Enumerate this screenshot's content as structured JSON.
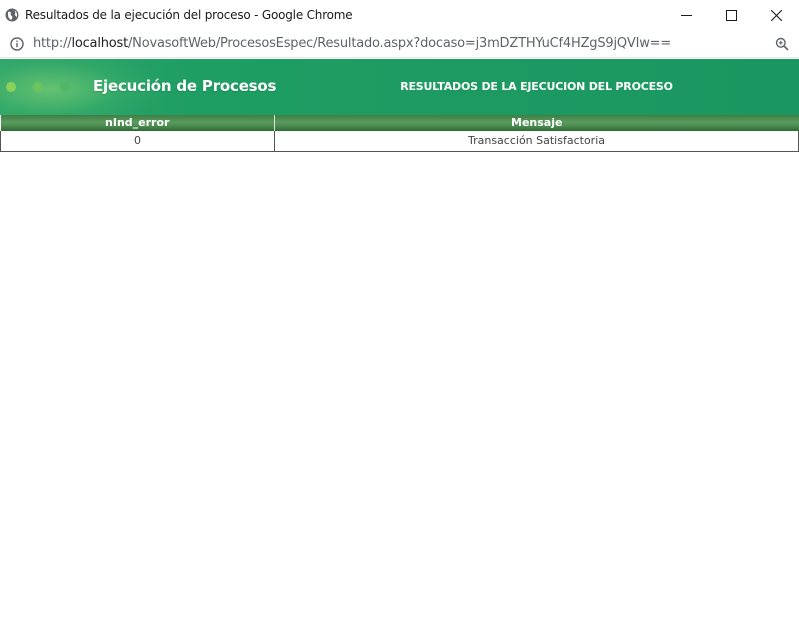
{
  "window": {
    "title": "Resultados de la ejecución del proceso - Google Chrome",
    "controls": {
      "minimize": "minimize-icon",
      "maximize": "maximize-icon",
      "close": "close-icon"
    }
  },
  "address": {
    "scheme": "http://",
    "host": "localhost",
    "path": "/NovasoftWeb/ProcesosEspec/Resultado.aspx?docaso=j3mDZTHYuCf4HZgS9jQVIw=="
  },
  "header": {
    "app_title": "Ejecución de Procesos",
    "page_title": "RESULTADOS DE LA EJECUCION DEL PROCESO"
  },
  "table": {
    "columns": [
      "nInd_error",
      "Mensaje"
    ],
    "rows": [
      [
        "0",
        "Transacción Satisfactoria"
      ]
    ]
  },
  "colors": {
    "header_green": "#1e9e63",
    "table_header_green": "#4a8a4e"
  }
}
